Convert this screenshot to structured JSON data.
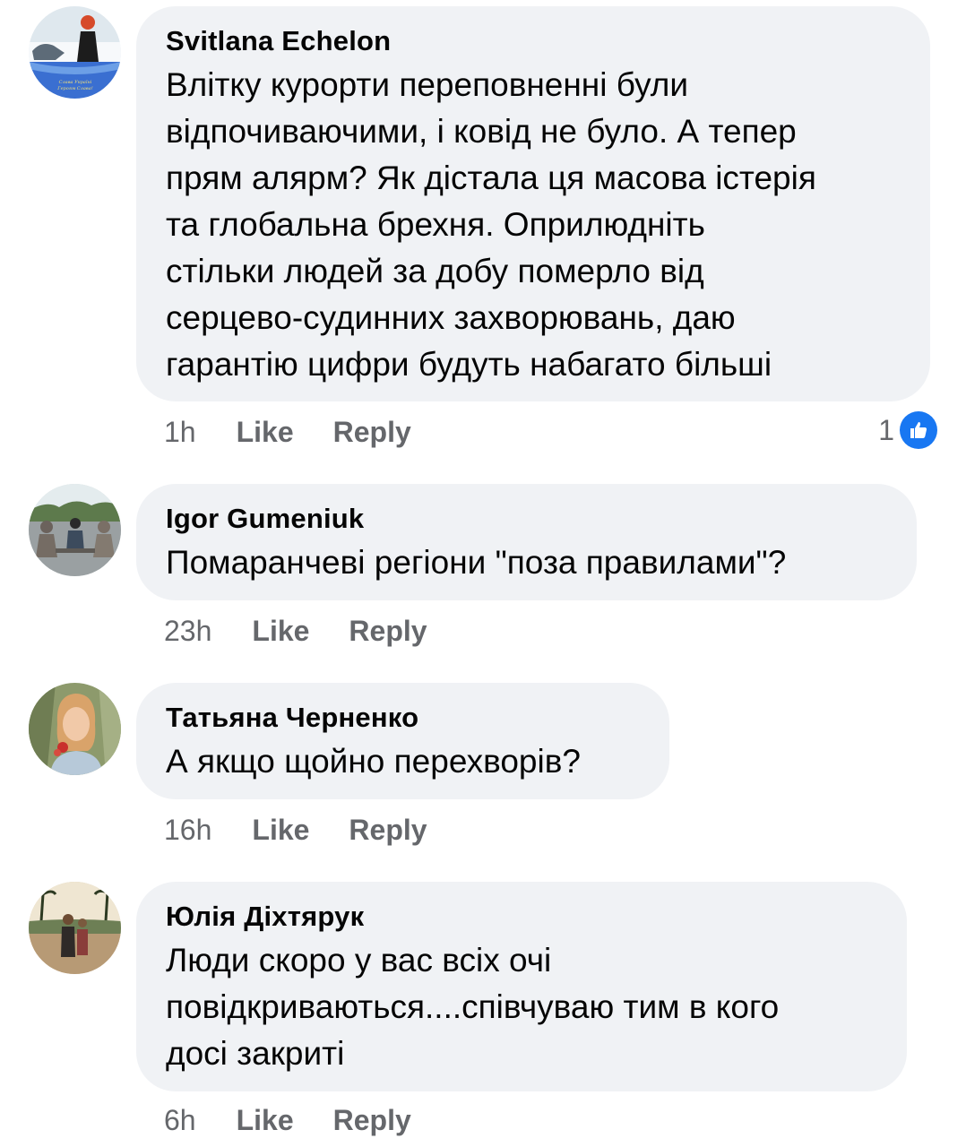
{
  "comments": [
    {
      "author": "Svitlana Echelon",
      "text": "Влітку курорти переповненні були\nвідпочиваючими, і ковід не було. А тепер\nпрям алярм? Як дістала ця масова істерія\nта глобальна брехня. Оприлюдніть\nстільки людей за добу померло від\nсерцево-судинних захворювань, даю\nгарантію цифри будуть набагато більші",
      "time": "1h",
      "like_label": "Like",
      "reply_label": "Reply",
      "reaction_count": "1",
      "reaction_icon": "thumbs-up-icon",
      "avatar_caption": "Слава Україні\nГероям Слава!"
    },
    {
      "author": "Igor Gumeniuk",
      "text": "Помаранчеві регіони \"поза правилами\"?",
      "time": "23h",
      "like_label": "Like",
      "reply_label": "Reply"
    },
    {
      "author": "Татьяна Черненко",
      "text": "А якщо щойно перехворів?",
      "time": "16h",
      "like_label": "Like",
      "reply_label": "Reply"
    },
    {
      "author": "Юлія Діхтярук",
      "text": "Люди скоро у вас всіх очі\nповідкриваються....співчуваю тим в кого\nдосі закриті",
      "time": "6h",
      "like_label": "Like",
      "reply_label": "Reply"
    }
  ],
  "colors": {
    "bubble": "#f0f2f5",
    "meta_text": "#65676b",
    "like_blue": "#1877f2"
  }
}
